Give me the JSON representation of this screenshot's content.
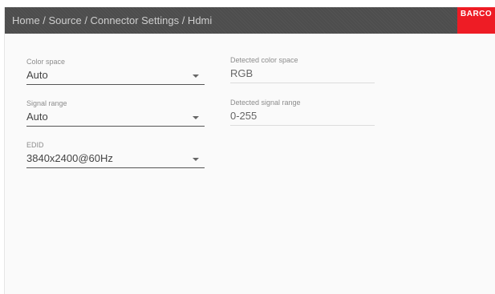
{
  "header": {
    "breadcrumb": "Home / Source / Connector Settings / Hdmi",
    "brand": "BARCO"
  },
  "settings": {
    "color_space": {
      "label": "Color space",
      "value": "Auto"
    },
    "signal_range": {
      "label": "Signal range",
      "value": "Auto"
    },
    "edid": {
      "label": "EDID",
      "value": "3840x2400@60Hz"
    }
  },
  "detected": {
    "color_space": {
      "label": "Detected color space",
      "value": "RGB"
    },
    "signal_range": {
      "label": "Detected signal range",
      "value": "0-255"
    }
  },
  "colors": {
    "header_bg": "#4d4d4d",
    "brand_red": "#ee1c25"
  },
  "icons": {
    "dropdown": "chevron-down-icon"
  }
}
